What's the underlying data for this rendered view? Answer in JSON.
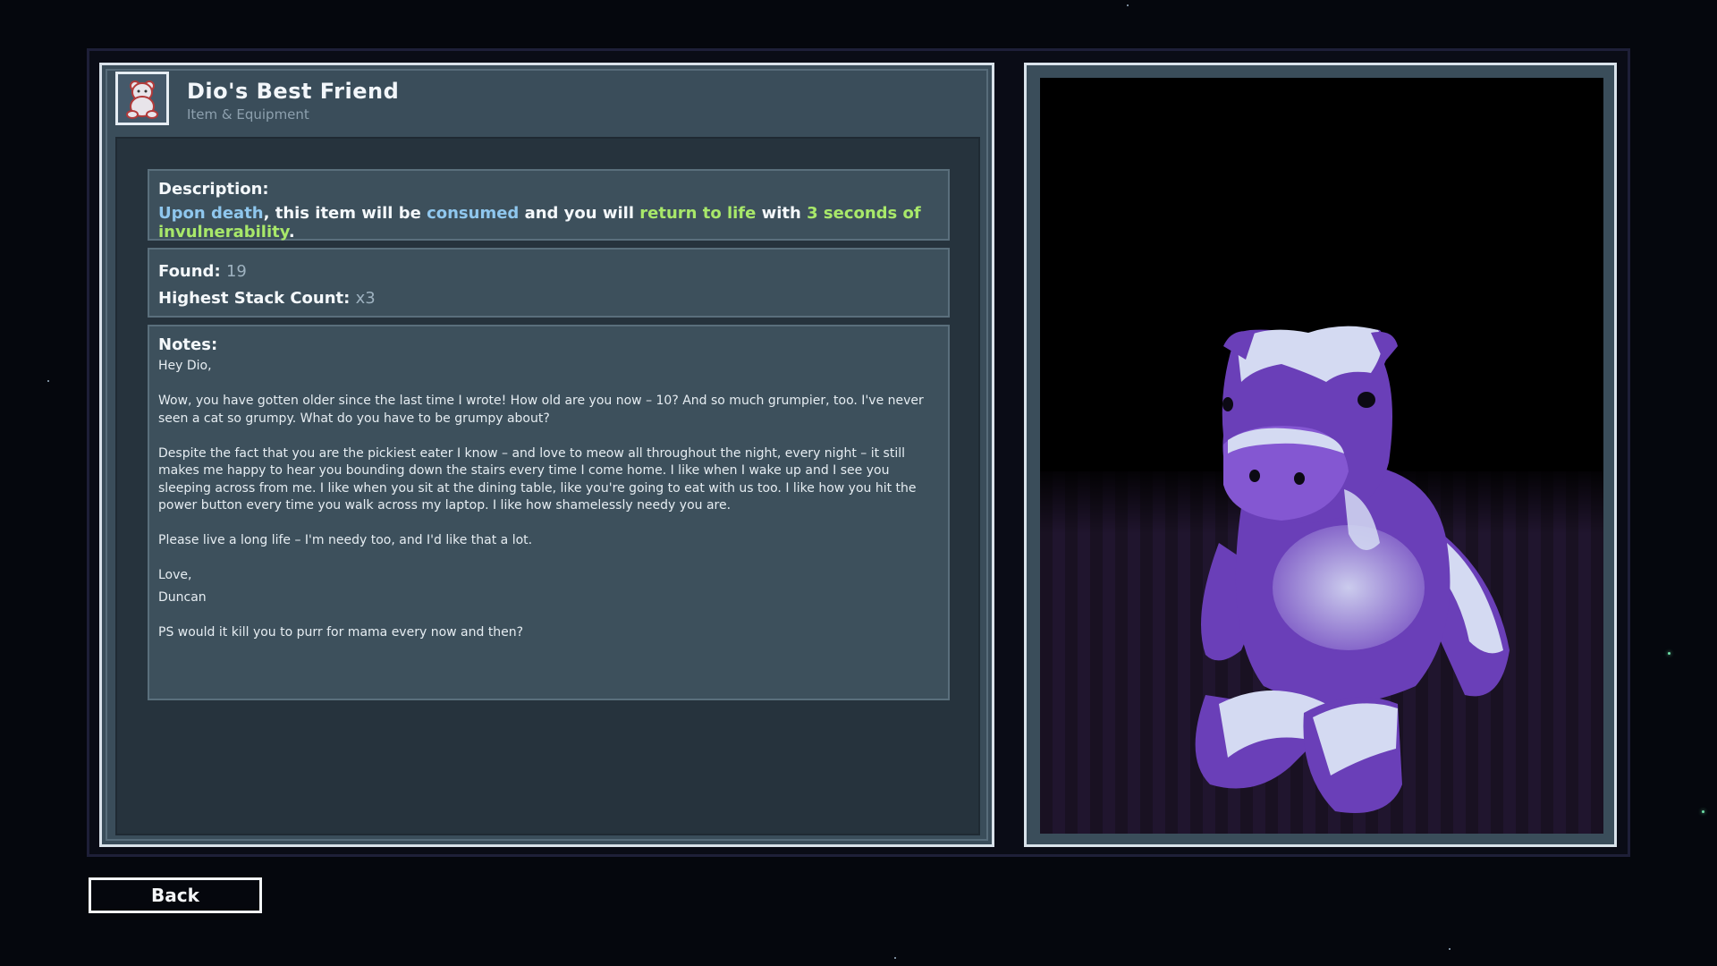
{
  "item": {
    "title": "Dio's Best Friend",
    "category": "Item & Equipment",
    "icon": "teddy-bear-icon"
  },
  "description": {
    "label": "Description:",
    "parts": [
      {
        "text": "Upon death",
        "color": "#8fc7ee"
      },
      {
        "text": ", this item will be ",
        "color": "#f4f8fb"
      },
      {
        "text": "consumed",
        "color": "#8fc7ee"
      },
      {
        "text": " and you will ",
        "color": "#f4f8fb"
      },
      {
        "text": "return to life",
        "color": "#a8e86a"
      },
      {
        "text": " with ",
        "color": "#f4f8fb"
      },
      {
        "text": "3 seconds of invulnerability",
        "color": "#a8e86a"
      },
      {
        "text": ".",
        "color": "#f4f8fb"
      }
    ]
  },
  "stats": {
    "found_label": "Found:",
    "found_value": "19",
    "stack_label": "Highest Stack Count:",
    "stack_value": "x3"
  },
  "notes": {
    "label": "Notes:",
    "greeting": "Hey Dio,",
    "para1": "Wow, you have gotten older since the last time I wrote! How old are you now – 10? And so much grumpier, too. I've never seen a cat so grumpy. What do you have to be grumpy about?",
    "para2": "Despite the fact that you are the pickiest eater I know – and love to meow all throughout the night, every night – it still makes me happy to hear you bounding down the stairs every time I come home. I like when I wake up and I see you sleeping across from me. I like when you sit at the dining table, like you're going to eat with us too. I like how you hit the power button every time you walk across my laptop. I like how shamelessly needy you are.",
    "para3": "Please live a long life – I'm needy too, and I'd like that a lot.",
    "signoff": "Love,",
    "signature": "Duncan",
    "ps": "PS would it kill you to purr for mama every now and then?"
  },
  "buttons": {
    "back": "Back"
  },
  "colors": {
    "accent_blue": "#8fc7ee",
    "accent_green": "#a8e86a",
    "bear_purple": "#6a3fb8",
    "bear_white": "#d4daf2"
  }
}
